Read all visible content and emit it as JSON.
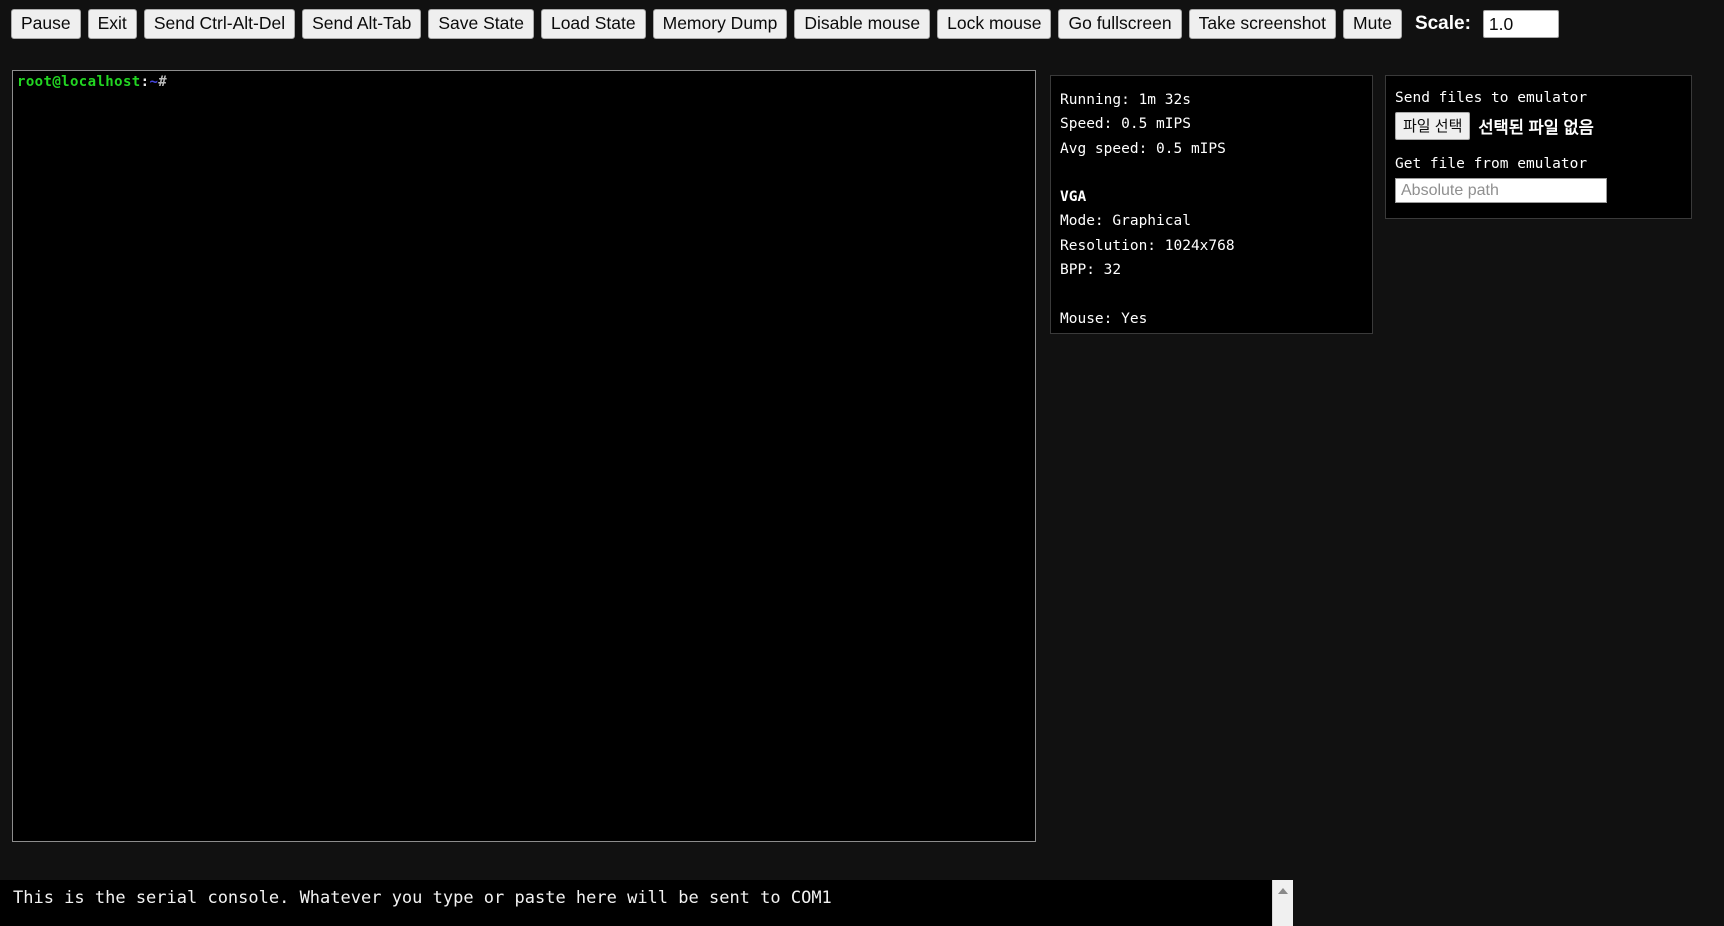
{
  "toolbar": {
    "buttons": [
      {
        "label": "Pause",
        "name": "pause-button"
      },
      {
        "label": "Exit",
        "name": "exit-button"
      },
      {
        "label": "Send Ctrl-Alt-Del",
        "name": "send-ctrl-alt-del-button"
      },
      {
        "label": "Send Alt-Tab",
        "name": "send-alt-tab-button"
      },
      {
        "label": "Save State",
        "name": "save-state-button"
      },
      {
        "label": "Load State",
        "name": "load-state-button"
      },
      {
        "label": "Memory Dump",
        "name": "memory-dump-button"
      },
      {
        "label": "Disable mouse",
        "name": "disable-mouse-button"
      },
      {
        "label": "Lock mouse",
        "name": "lock-mouse-button"
      },
      {
        "label": "Go fullscreen",
        "name": "go-fullscreen-button"
      },
      {
        "label": "Take screenshot",
        "name": "take-screenshot-button"
      },
      {
        "label": "Mute",
        "name": "mute-button"
      }
    ],
    "scale_label": "Scale:",
    "scale_value": "1.0"
  },
  "vga": {
    "prompt_user_host": "root@localhost",
    "prompt_colon": ":",
    "prompt_path": "~",
    "prompt_sigil": "#"
  },
  "info": {
    "running_label": "Running:",
    "running_value": "1m 32s",
    "speed_label": "Speed:",
    "speed_value": "0.5 mIPS",
    "avg_speed_label": "Avg speed:",
    "avg_speed_value": "0.5 mIPS",
    "vga_section_title": "VGA",
    "mode_label": "Mode:",
    "mode_value": "Graphical",
    "resolution_label": "Resolution:",
    "resolution_value": "1024x768",
    "bpp_label": "BPP:",
    "bpp_value": "32",
    "mouse_label": "Mouse:",
    "mouse_value": "Yes",
    "line_running": "Running: 1m 32s",
    "line_speed": "Speed: 0.5 mIPS",
    "line_avg_speed": "Avg speed: 0.5 mIPS",
    "line_mode": "Mode: Graphical",
    "line_resolution": "Resolution: 1024x768",
    "line_bpp": "BPP: 32",
    "line_mouse": "Mouse: Yes"
  },
  "files": {
    "send_label": "Send files to emulator",
    "file_select_button": "파일 선택",
    "file_status": "선택된 파일 없음",
    "get_label": "Get file from emulator",
    "abs_path_placeholder": "Absolute path",
    "abs_path_value": ""
  },
  "serial": {
    "text": "This is the serial console. Whatever you type or paste here will be sent to COM1"
  },
  "colors": {
    "page_background": "#111111",
    "screen_background": "#000000",
    "button_face": "#efefef",
    "prompt_green": "#22d522",
    "prompt_blue": "#4646e0",
    "panel_border": "#3a3a3a",
    "screen_border": "#8d8d8d"
  }
}
